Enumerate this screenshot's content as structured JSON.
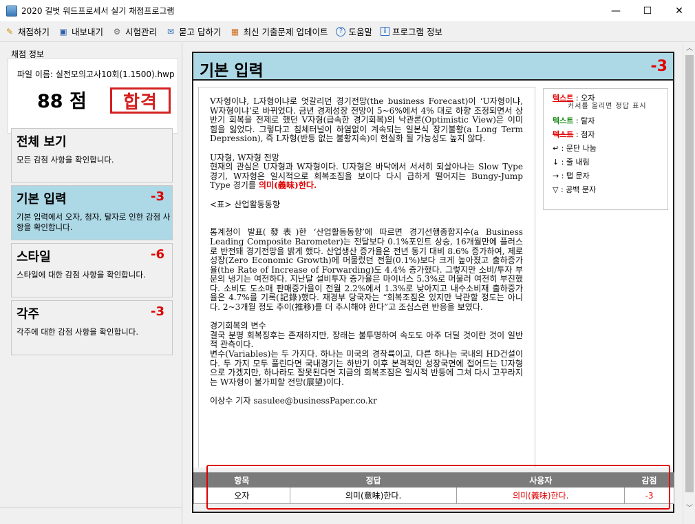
{
  "window": {
    "title": "2020 길벗 워드프로세서 실기 채점프로그램",
    "minimize": "—",
    "maximize": "☐",
    "close": "✕"
  },
  "menu": [
    {
      "label": "채점하기",
      "icon": "pencil-icon",
      "glyph": "✎",
      "color": "#c89000"
    },
    {
      "label": "내보내기",
      "icon": "save-icon",
      "glyph": "▣",
      "color": "#2a5ea8"
    },
    {
      "label": "시험관리",
      "icon": "gear-icon",
      "glyph": "⚙",
      "color": "#707070"
    },
    {
      "label": "묻고 답하기",
      "icon": "chat-icon",
      "glyph": "✉",
      "color": "#3070b8"
    },
    {
      "label": "최신 기출문제 업데이트",
      "icon": "gift-icon",
      "glyph": "▦",
      "color": "#d07020"
    },
    {
      "label": "도움말",
      "icon": "help-icon",
      "glyph": "?",
      "color": "#2a70c8"
    },
    {
      "label": "프로그램 정보",
      "icon": "info-icon",
      "glyph": "i",
      "color": "#2a70c8"
    }
  ],
  "score_info": {
    "group_label": "채점 정보",
    "file_name": "파일 이름: 실전모의고사10회(1.1500).hwp",
    "score": "88 점",
    "stamp": "합격"
  },
  "categories": [
    {
      "title": "전체 보기",
      "deduct": "",
      "desc": "모든 감점 사항을 확인합니다."
    },
    {
      "title": "기본 입력",
      "deduct": "-3",
      "desc": "기본 입력에서 오자, 첨자, 탈자로 인한 감점 사항을 확인합니다."
    },
    {
      "title": "스타일",
      "deduct": "-6",
      "desc": "스타일에 대한 감점 사항을 확인합니다."
    },
    {
      "title": "각주",
      "deduct": "-3",
      "desc": "각주에 대한 감점 사항을 확인합니다."
    }
  ],
  "doc": {
    "title": "기본 입력",
    "deduct": "-3",
    "p1": "V자형이냐, L자형이냐로 엇갈리던 경기전망(the business Forecast)이 ‘U자형이냐, W자형이냐’로 바뀌었다. 금년 경제성장 전망이 5~6%에서 4% 대로 하향 조정되면서 상반기 회복을 전제로 했던 V자형(급속한 경기회복)의 낙관론(Optimistic View)은 이미 힘을 잃었다. 그렇다고 침체터널이 하염없이 계속되는 일본식 장기불황(a Long Term Depression), 즉 L자형(반등 없는 불황지속)이 현실화 될 가능성도 높지 않다.",
    "p2_head": "U자형, W자형 전망",
    "p2_body": "현재의 관심은 U자형과 W자형이다. U자형은 바닥에서 서서히 되살아나는 Slow Type 경기, W자형은 일시적으로 회복조짐을 보이다 다시 급하게 떨어지는 Bungy-Jump Type 경기를 ",
    "p2_red": "의미(義味)한다.",
    "table_caption": "<표> 산업활동동향",
    "p3": "통계청이 발표(發表)한 ‘산업활동동향’에 따르면 경기선행종합지수(a Business Leading Composite Barometer)는 전달보다 0.1%포인트 상승, 16개월만에 플러스로 반전돼 경기전망을 밝게 했다. 산업생산 증가율은 전년 동기 대비 8.6% 증가하여, 제로성장(Zero Economic Growth)에 머물렀던 전월(0.1%)보다 크게 높아졌고 출하증가율(the Rate of Increase of Forwarding)도 4.4% 증가했다. 그렇지만 소비/투자 부문의 냉기는 여전하다. 지난달 설비투자 증가율은 마이너스 5.3%로 머물러 여전히 부진했다. 소비도 도소매 판매증가율이 전월 2.2%에서 1.3%로 낮아지고 내수소비재 출하증가율은 4.7%를 기록(記錄)했다. 재경부 당국자는 “회복조짐은 있지만 낙관할 정도는 아니다. 2~3개월 정도 추이(推移)를 더 추시해야 한다”고 조심스런 반응을 보였다.",
    "p4_head": "경기회복의 변수",
    "p4_a": "결국 분명 회복징후는 존재하지만, 장래는 불투명하여 속도도 아주 더딜 것이란 것이 일반적 관측이다.",
    "p4_b": "변수(Variables)는 두 가지다. 하나는 미국의 경착륙이고, 다른 하나는 국내의 HD건설이다. 두 가지 모두 풀린다면 국내경기는 하반기 이후 본격적인 성장국면에 접어드는 U자형으로 가겠지만, 하나라도 잘못된다면 지금의 회복조짐은 일시적 반등에 그쳐 다시 고꾸라지는 W자형이 불가피할 전망(展望)이다.",
    "byline": "이상수 기자 sasulee@businessPaper.co.kr"
  },
  "legend": {
    "typo_word": "텍스트",
    "typo_label": ": 오자",
    "typo_hint": "커서를 올리면 정답 표시",
    "omit_word": "텍스트",
    "omit_label": ": 탈자",
    "add_word": "텍스트",
    "add_label": ": 첨자",
    "para_sym": "↵ : 문단 나눔",
    "line_sym": "↓ : 줄 내림",
    "tab_sym": "→ : 탭 문자",
    "space_sym": "▽ : 공백 문자"
  },
  "result_table": {
    "headers": [
      "항목",
      "정답",
      "사용자",
      "감점"
    ],
    "rows": [
      [
        "오자",
        "의미(意味)한다.",
        "의미(義味)한다.",
        "-3"
      ]
    ]
  }
}
